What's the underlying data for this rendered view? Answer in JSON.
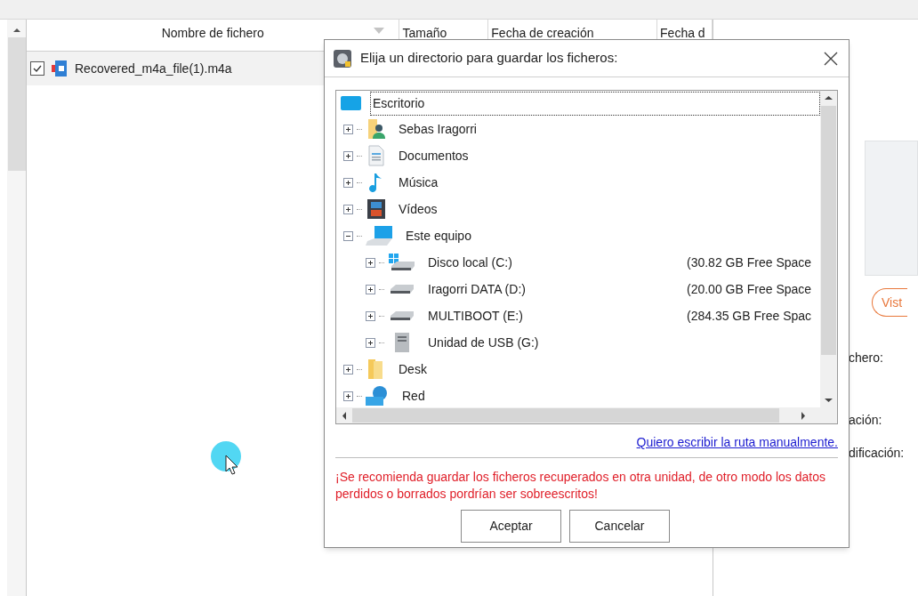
{
  "table": {
    "columns": [
      "Nombre de fichero",
      "Tamaño",
      "Fecha de creación",
      "Fecha d"
    ],
    "rows": [
      {
        "checked": true,
        "name": "Recovered_m4a_file(1).m4a"
      }
    ]
  },
  "details": {
    "button": "Vist",
    "labels": [
      "chero:",
      "ación:",
      "dificación:"
    ]
  },
  "dialog": {
    "title": "Elija un directorio para guardar los ficheros:",
    "tree": [
      {
        "label": "Escritorio",
        "kind": "desktop",
        "selected": true,
        "children": [
          {
            "label": "Sebas Iragorri",
            "kind": "user",
            "expanded": false,
            "selected": false
          },
          {
            "label": "Documentos",
            "kind": "documents",
            "expanded": false,
            "selected": false
          },
          {
            "label": "Música",
            "kind": "music",
            "expanded": false,
            "selected": false
          },
          {
            "label": "Vídeos",
            "kind": "videos",
            "expanded": false,
            "selected": false
          },
          {
            "label": "Este equipo",
            "kind": "computer",
            "expanded": true,
            "selected": false,
            "children": [
              {
                "label": "Disco local (C:)",
                "kind": "system-drive",
                "expanded": false,
                "selected": false,
                "free_space": "(30.82 GB Free Space"
              },
              {
                "label": "Iragorri DATA (D:)",
                "kind": "drive",
                "expanded": false,
                "selected": false,
                "free_space": "(20.00 GB Free Space"
              },
              {
                "label": "MULTIBOOT (E:)",
                "kind": "drive",
                "expanded": false,
                "selected": false,
                "free_space": "(284.35 GB Free Spac"
              },
              {
                "label": "Unidad de USB (G:)",
                "kind": "usb-drive",
                "expanded": false,
                "selected": false
              }
            ]
          },
          {
            "label": "Desk",
            "kind": "folder",
            "expanded": false,
            "selected": false
          },
          {
            "label": "Red",
            "kind": "network",
            "expanded": false,
            "selected": false
          }
        ]
      }
    ],
    "link": "Quiero escribir la ruta manualmente.",
    "warning": "¡Se recomienda guardar los ficheros recuperados en otra unidad, de otro modo los datos perdidos o borrados pordrían ser sobreescritos!",
    "buttons": [
      "Aceptar",
      "Cancelar"
    ]
  }
}
